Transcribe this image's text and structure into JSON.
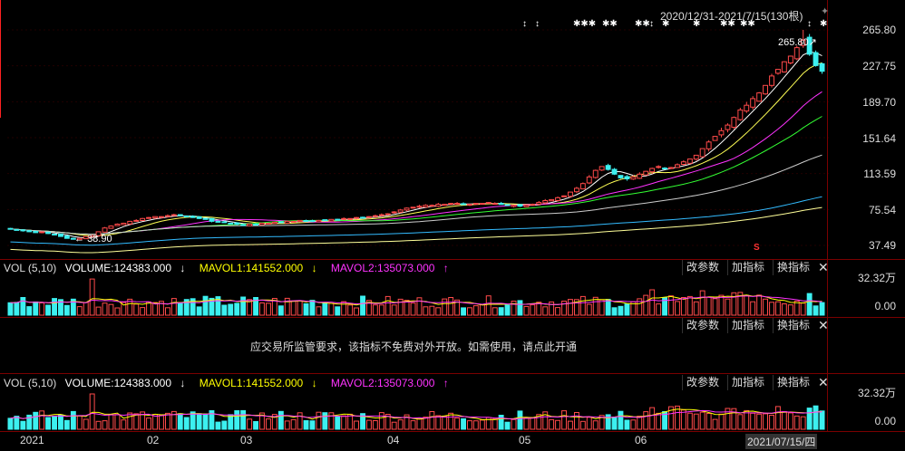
{
  "range_label": "2020/12/31-2021/7/15(130根)",
  "colors": {
    "up": "#ff4a4a",
    "down": "#3cf0f0",
    "ma5": "#ffffff",
    "ma10": "#ffff55",
    "ma20": "#ff33ff",
    "ma30": "#33ff33",
    "ma60": "#cccccc",
    "ma120": "#33bbff",
    "ma250": "#ffff99",
    "vol_ma1": "#ffff00",
    "vol_ma2": "#ff33ff"
  },
  "price_axis": [
    "265.80",
    "227.75",
    "189.70",
    "151.64",
    "113.59",
    "75.54",
    "37.49"
  ],
  "max_label": "265.80",
  "min_label": "38.90",
  "star_marks": [
    "↕",
    "↕",
    "✱✱✱",
    "✱✱",
    "✱✱",
    "↕",
    "✱",
    "✱",
    "✱✱",
    "✱✱",
    "↕",
    "✱",
    "✱"
  ],
  "s_mark": "S",
  "vol_panel_1": {
    "name": "VOL (5,10)",
    "volume": "VOLUME:124383.000",
    "volume_arrow": "↓",
    "mavol1": "MAVOL1:141552.000",
    "mavol1_arrow": "↓",
    "mavol2": "MAVOL2:135073.000",
    "mavol2_arrow": "↑",
    "axis_top": "32.32万",
    "axis_bottom": "0.00",
    "buttons": [
      "改参数",
      "加指标",
      "换指标"
    ],
    "close": "✕"
  },
  "locked_panel": {
    "buttons": [
      "改参数",
      "加指标",
      "换指标"
    ],
    "close": "✕",
    "notice": "应交易所监管要求，该指标不免费对外开放。如需使用，请点此开通"
  },
  "vol_panel_2": {
    "name": "VOL (5,10)",
    "volume": "VOLUME:124383.000",
    "volume_arrow": "↓",
    "mavol1": "MAVOL1:141552.000",
    "mavol1_arrow": "↓",
    "mavol2": "MAVOL2:135073.000",
    "mavol2_arrow": "↑",
    "axis_top": "32.32万",
    "axis_bottom": "0.00",
    "buttons": [
      "改参数",
      "加指标",
      "换指标"
    ],
    "close": "✕"
  },
  "date_axis": [
    "2021",
    "02",
    "03",
    "04",
    "05",
    "06",
    "2021/07/15/四"
  ],
  "chart_data": {
    "type": "candlestick",
    "period_count": 130,
    "start": "2020/12/31",
    "end": "2021/7/15",
    "price_ylim": [
      37.49,
      265.8
    ],
    "price_max": 265.8,
    "price_min": 38.9,
    "close_series": [
      55,
      54,
      53,
      52,
      51,
      52,
      50,
      49,
      47,
      45,
      44,
      45,
      47,
      48,
      52,
      56,
      58,
      60,
      61,
      63,
      64,
      66,
      67,
      68,
      68,
      69,
      70,
      69,
      68,
      67,
      66,
      65,
      63,
      62,
      62,
      61,
      60,
      59,
      60,
      60,
      61,
      61,
      62,
      62,
      63,
      63,
      64,
      63,
      63,
      64,
      64,
      65,
      65,
      66,
      66,
      67,
      67,
      68,
      69,
      70,
      71,
      73,
      75,
      77,
      78,
      79,
      80,
      80,
      81,
      81,
      82,
      82,
      81,
      81,
      82,
      82,
      83,
      82,
      81,
      80,
      80,
      79,
      80,
      81,
      83,
      85,
      86,
      88,
      90,
      94,
      98,
      103,
      110,
      117,
      121,
      118,
      113,
      109,
      108,
      110,
      113,
      116,
      119,
      121,
      119,
      120,
      123,
      126,
      129,
      133,
      140,
      147,
      153,
      159,
      165,
      173,
      181,
      186,
      193,
      199,
      207,
      217,
      224,
      232,
      238,
      247,
      255,
      240,
      228,
      222
    ],
    "volume_ylim": [
      0,
      32.32
    ],
    "volume_unit": "万",
    "volume_last": 124383.0,
    "mavol1_last": 141552.0,
    "mavol2_last": 135073.0
  }
}
